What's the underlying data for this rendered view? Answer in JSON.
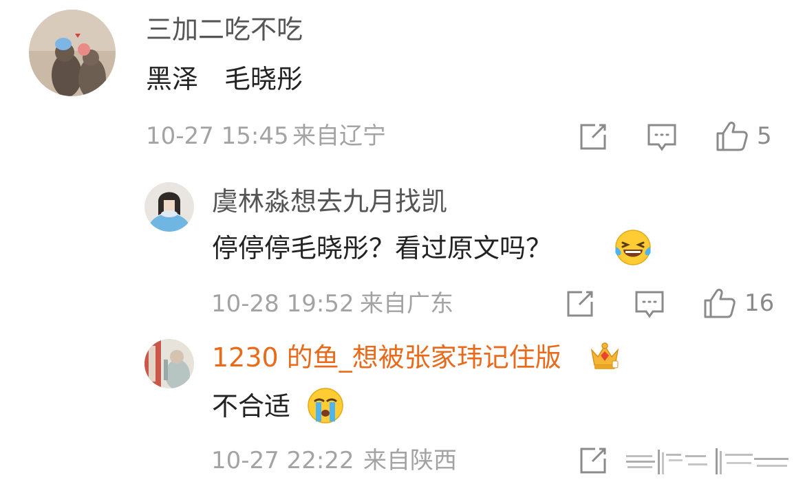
{
  "comments": [
    {
      "username": "三加二吃不吃",
      "text": "黑泽　毛晓彤",
      "timestamp": "10-27 15:45",
      "location": "来自辽宁",
      "likes": "5"
    },
    {
      "username": "虞林淼想去九月找凯",
      "text": "停停停毛晓彤？看过原文吗？",
      "emoji": "laughing-tears-emoji",
      "timestamp": "10-28 19:52",
      "location": "来自广东",
      "likes": "16"
    },
    {
      "username": "1230 的鱼_想被张家玮记住版",
      "badge": "vip-crown-icon",
      "text": "不合适",
      "emoji": "crying-emoji",
      "timestamp": "10-27 22:22",
      "location": "来自陕西"
    }
  ],
  "colors": {
    "username_vip": "#e86a1a",
    "username": "#555555",
    "text": "#222222",
    "meta": "#a3a3a3",
    "icon": "#8a8a8a"
  }
}
